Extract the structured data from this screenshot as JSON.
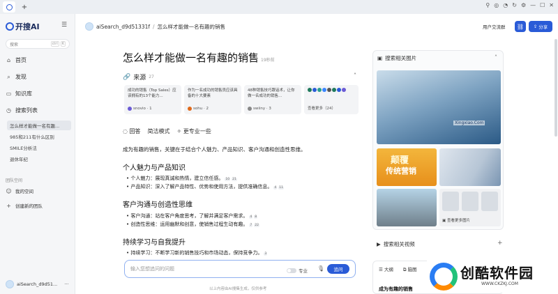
{
  "tabbar": {
    "new_tab": "+"
  },
  "sidebar": {
    "logo_text": "开搜AI",
    "search_placeholder": "搜索",
    "kbd": [
      "ctrl",
      "K"
    ],
    "nav": [
      {
        "label": "首页",
        "icon": "home-icon"
      },
      {
        "label": "发现",
        "icon": "compass-icon"
      },
      {
        "label": "知识库",
        "icon": "book-icon"
      },
      {
        "label": "搜索列表",
        "icon": "history-icon"
      }
    ],
    "history": [
      "怎么样才能做一名有趣...",
      "985和211有什么区别",
      "SMILE分析法",
      "退休年纪"
    ],
    "team_section": "团队空间",
    "my_space": "我的空间",
    "create_team": "创建新的团队",
    "user_name": "aiSearch_d9d51...",
    "user_more": "···"
  },
  "header": {
    "user": "aiSearch_d9d51331f",
    "sep": "/",
    "title": "怎么样才能做一名有趣的销售",
    "community": "用户交流群",
    "share": "分享"
  },
  "main": {
    "title": "怎么样才能做一名有趣的销售",
    "time": "19秒前",
    "sources_label": "来源",
    "sources_count": "27",
    "cards": [
      {
        "text": "成功的销售（Top Sales）应该拥有的13个能力...",
        "source": "snovio · 1"
      },
      {
        "text": "作为一名成功的销售员应该具备的十大要素",
        "source": "sohu · 2"
      },
      {
        "text": "48种销售技巧跟话术，让你做一名成功的销售...",
        "source": "swiiny · 3"
      }
    ],
    "more_label": "查看更多（24）",
    "tabs": [
      "回答",
      "简洁模式",
      "更专业一些"
    ],
    "intro": "成为有趣的销售，关键在于结合个人魅力、产品知识、客户沟通和创造性思维。",
    "sections": [
      {
        "heading": "个人魅力与产品知识",
        "bullets": [
          {
            "text": "个人魅力：展现真诚和热情，建立信任感。",
            "refs": [
              "10",
              "21"
            ]
          },
          {
            "text": "产品知识：深入了解产品特性、优势和使用方法，提供准确信息。",
            "refs": [
              "4",
              "11"
            ]
          }
        ]
      },
      {
        "heading": "客户沟通与创造性思维",
        "bullets": [
          {
            "text": "客户沟通：站在客户角度思考，了解并满足客户需求。",
            "refs": [
              "4",
              "8"
            ]
          },
          {
            "text": "创造性思维：运用幽默和创意，使销售过程生动有趣。",
            "refs": [
              "7",
              "22"
            ]
          }
        ]
      },
      {
        "heading": "持续学习与自我提升",
        "bullets": [
          {
            "text": "持续学习：不断学习新的销售技巧和市场动态，保持竞争力。",
            "refs": [
              "3"
            ]
          }
        ]
      }
    ],
    "ask_placeholder": "输入您想追问的问题",
    "pro_label": "专业",
    "ask_button": "追问",
    "footer_note": "以上内容由AI搜集生成，仅供参考"
  },
  "right": {
    "images_title": "搜索相关图片",
    "img2_line1": "颠覆",
    "img2_line2": "传统营销",
    "watermark": "Xingxiao.Com",
    "more_images": "查看更多图片",
    "videos_title": "搜索相关视频",
    "outline_tabs": [
      "大纲",
      "脑图"
    ],
    "outline_title": "成为有趣的销售"
  },
  "brand": {
    "name": "创酷软件园",
    "url": "WWW.CKZKJ.COM"
  }
}
